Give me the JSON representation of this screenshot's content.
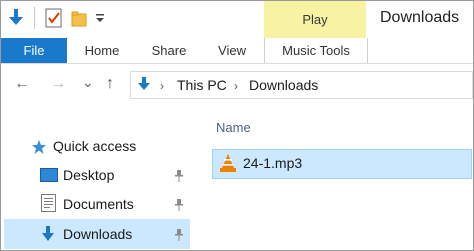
{
  "window": {
    "title": "Downloads"
  },
  "ribbon": {
    "contextual_tab": "Play",
    "tabs": [
      "File",
      "Home",
      "Share",
      "View",
      "Music Tools"
    ]
  },
  "nav": {
    "back_glyph": "←",
    "forward_glyph": "→",
    "recent_glyph": "⌄",
    "up_glyph": "↑"
  },
  "address": {
    "segments": [
      "This PC",
      "Downloads"
    ]
  },
  "sidebar": {
    "quick_access": "Quick access",
    "items": [
      {
        "label": "Desktop",
        "icon": "desktop-icon",
        "pinned": true
      },
      {
        "label": "Documents",
        "icon": "documents-icon",
        "pinned": true
      },
      {
        "label": "Downloads",
        "icon": "downloads-icon",
        "pinned": true,
        "selected": true
      }
    ]
  },
  "content": {
    "column_name": "Name",
    "files": [
      {
        "name": "24-1.mp3",
        "icon": "vlc-icon",
        "selected": true
      }
    ]
  },
  "colors": {
    "accent": "#1979ca",
    "selection": "#cce8ff",
    "contextual": "#f7f3a3"
  }
}
